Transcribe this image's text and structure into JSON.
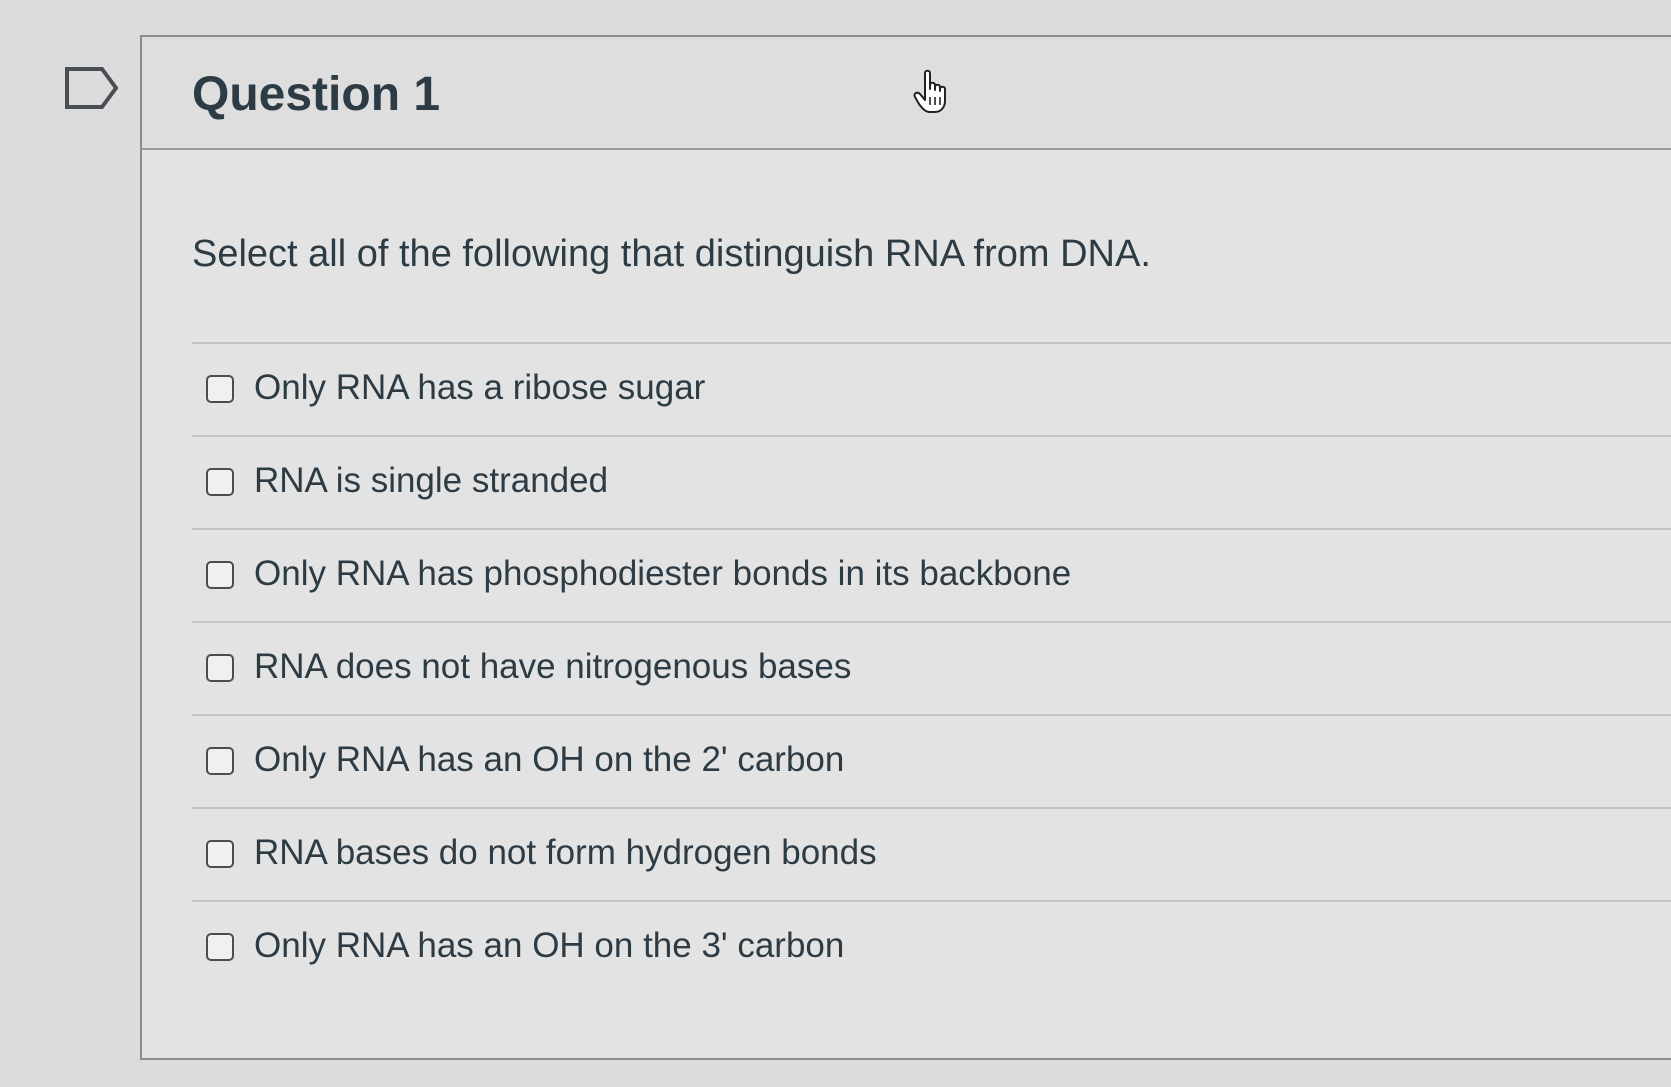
{
  "question": {
    "title": "Question 1",
    "prompt": "Select all of the following that distinguish RNA from DNA.",
    "options": [
      {
        "label": "Only RNA has a ribose sugar",
        "checked": false
      },
      {
        "label": "RNA is single stranded",
        "checked": false
      },
      {
        "label": "Only RNA has phosphodiester bonds in its backbone",
        "checked": false
      },
      {
        "label": "RNA does not have nitrogenous bases",
        "checked": false
      },
      {
        "label": "Only RNA has an OH on the 2' carbon",
        "checked": false
      },
      {
        "label": "RNA bases do not form hydrogen bonds",
        "checked": false
      },
      {
        "label": "Only RNA has an OH on the 3' carbon",
        "checked": false
      }
    ]
  },
  "icons": {
    "flag": "flag-question-icon",
    "cursor": "hand-pointer-icon"
  }
}
